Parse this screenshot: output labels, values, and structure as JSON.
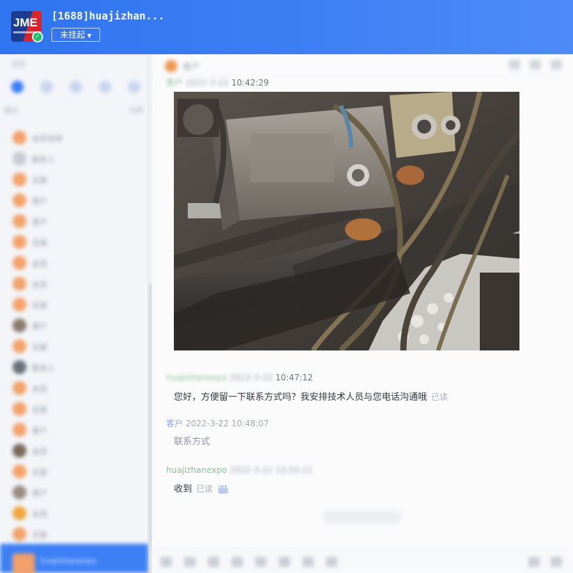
{
  "header": {
    "logo_text": "JME",
    "shop_name": "[1688]huajizhan...",
    "status": "未挂起"
  },
  "sidebar": {
    "search_placeholder": "搜索",
    "sort_left": "最近",
    "sort_right": "全部",
    "contacts": [
      {
        "name": "会员名称",
        "avatar_color": "#f3a36b"
      },
      {
        "name": "联系人",
        "avatar_color": "#c9ccd2"
      },
      {
        "name": "买家",
        "avatar_color": "#f3a36b"
      },
      {
        "name": "客户",
        "avatar_color": "#f3a36b"
      },
      {
        "name": "客户",
        "avatar_color": "#f3a36b"
      },
      {
        "name": "买家",
        "avatar_color": "#f3a36b"
      },
      {
        "name": "会员",
        "avatar_color": "#f3a36b"
      },
      {
        "name": "会员",
        "avatar_color": "#f3a36b"
      },
      {
        "name": "买家",
        "avatar_color": "#f3a36b"
      },
      {
        "name": "客户",
        "avatar_color": "#8a7c6e"
      },
      {
        "name": "买家",
        "avatar_color": "#f3a36b"
      },
      {
        "name": "联系人",
        "avatar_color": "#6b6f77"
      },
      {
        "name": "会员",
        "avatar_color": "#f3a36b"
      },
      {
        "name": "买家",
        "avatar_color": "#f3a36b"
      },
      {
        "name": "客户",
        "avatar_color": "#f3a36b"
      },
      {
        "name": "会员",
        "avatar_color": "#7a6a5a"
      },
      {
        "name": "买家",
        "avatar_color": "#f3a36b"
      },
      {
        "name": "客户",
        "avatar_color": "#9a8c80"
      },
      {
        "name": "会员",
        "avatar_color": "#f1a53d"
      },
      {
        "name": "买家",
        "avatar_color": "#f3a36b"
      }
    ],
    "current_user": "huajizhanexpo"
  },
  "chat": {
    "contact_name": "客户",
    "messages": [
      {
        "sender": "客户",
        "date": "2022-3-22",
        "time": "10:42:29",
        "type": "image"
      },
      {
        "sender": "huajizhanexpo",
        "date": "2022-3-22",
        "time": "10:47:12",
        "text": "您好，方便留一下联系方式吗？我安排技术人员与您电话沟通哦",
        "read": "已读"
      },
      {
        "sender": "客户",
        "date": "2022-3-22",
        "time": "10:48:07",
        "text": "联系方式"
      },
      {
        "sender": "huajizhanexpo",
        "date": "2022-3-22",
        "time": "10:50:21",
        "text": "收到",
        "read": "已读",
        "more": "•••"
      }
    ]
  }
}
